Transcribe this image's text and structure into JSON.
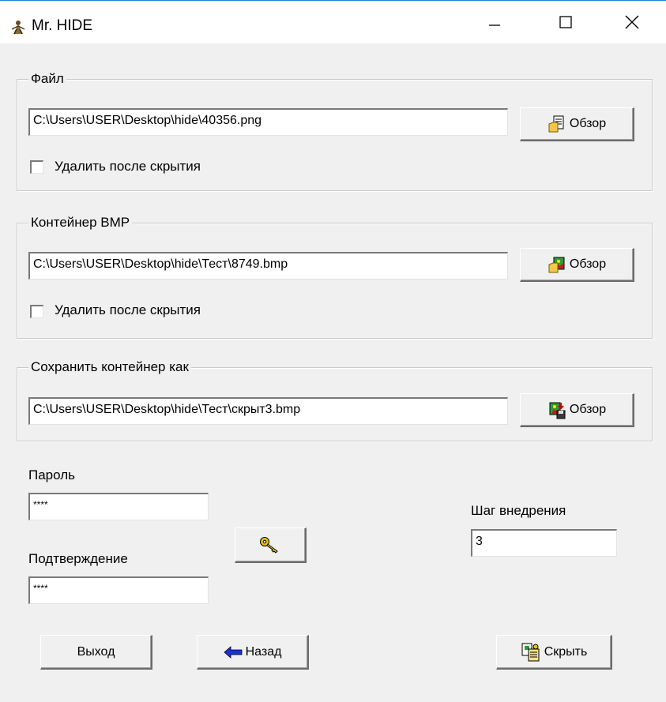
{
  "window": {
    "title": "Mr. HIDE",
    "icons": {
      "app": "bee-icon",
      "minimize": "minimize-icon",
      "maximize": "maximize-icon",
      "close": "close-icon"
    }
  },
  "file_group": {
    "label": "Файл",
    "path": "C:\\Users\\USER\\Desktop\\hide\\40356.png",
    "browse_label": "Обзор",
    "delete_after_hide": "Удалить после скрытия",
    "delete_checked": false
  },
  "container_group": {
    "label": "Контейнер BMP",
    "path": "C:\\Users\\USER\\Desktop\\hide\\Тест\\8749.bmp",
    "browse_label": "Обзор",
    "delete_after_hide": "Удалить после скрытия",
    "delete_checked": false
  },
  "save_group": {
    "label": "Сохранить контейнер как",
    "path": "C:\\Users\\USER\\Desktop\\hide\\Тест\\скрыт3.bmp",
    "browse_label": "Обзор"
  },
  "password": {
    "label": "Пароль",
    "value": "****",
    "confirm_label": "Подтверждение",
    "confirm_value": "****"
  },
  "step": {
    "label": "Шаг внедрения",
    "value": "3"
  },
  "buttons": {
    "exit": "Выход",
    "back": "Назад",
    "hide": "Скрыть"
  },
  "colors": {
    "window_bg": "#f0f0f0",
    "accent_border": "#1883d7",
    "back_arrow": "#1d2fd6",
    "key_yellow": "#e8c400"
  }
}
